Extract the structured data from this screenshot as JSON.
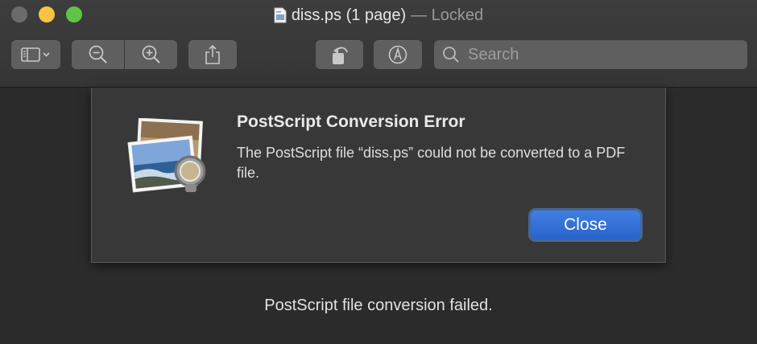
{
  "window": {
    "title": "diss.ps (1 page)",
    "title_suffix": "— Locked"
  },
  "toolbar": {
    "buttons": [
      {
        "name": "sidebar",
        "icon": "sidebar-icon"
      },
      {
        "name": "zoom-out",
        "icon": "zoom-out-icon"
      },
      {
        "name": "zoom-in",
        "icon": "zoom-in-icon"
      },
      {
        "name": "share",
        "icon": "share-icon"
      },
      {
        "name": "rotate",
        "icon": "rotate-left-icon"
      },
      {
        "name": "markup",
        "icon": "markup-pen-icon"
      }
    ],
    "search": {
      "placeholder": "Search",
      "value": ""
    }
  },
  "dialog": {
    "title": "PostScript Conversion Error",
    "message": "The PostScript file “diss.ps” could not be converted to a PDF file.",
    "close_label": "Close",
    "icon": "preview-app-icon"
  },
  "status_text": "PostScript file conversion failed.",
  "colors": {
    "accent": "#2f6bd6",
    "background": "#2b2b2b",
    "traffic_close": "#6b6b6b",
    "traffic_minimize": "#f6c441",
    "traffic_zoom": "#5fc447"
  }
}
